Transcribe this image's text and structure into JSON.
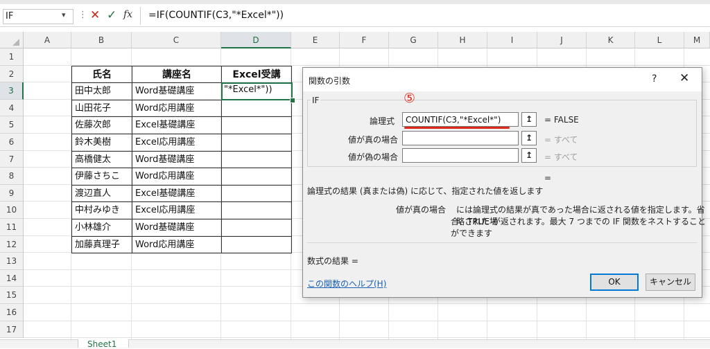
{
  "formula_bar": {
    "name_box": "IF",
    "dropdown_icon": "chevron-down-icon",
    "separator": "⋮",
    "cancel_icon": "✕",
    "enter_icon": "✓",
    "fx_label": "fx",
    "formula": "=IF(COUNTIF(C3,\"*Excel*\"))"
  },
  "grid": {
    "columns": [
      "A",
      "B",
      "C",
      "D",
      "E",
      "F",
      "G",
      "H",
      "I",
      "J",
      "K",
      "L",
      "M"
    ],
    "rows": [
      "1",
      "2",
      "3",
      "4",
      "5",
      "6",
      "7",
      "8",
      "9",
      "10",
      "11",
      "12",
      "13",
      "14",
      "15",
      "16",
      "17"
    ],
    "selected_column": "D",
    "selected_row": "3"
  },
  "table": {
    "headers": [
      "氏名",
      "講座名",
      "Excel受講"
    ],
    "rows": [
      [
        "田中太郎",
        "Word基礎講座"
      ],
      [
        "山田花子",
        "Word応用講座"
      ],
      [
        "佐藤次郎",
        "Excel基礎講座"
      ],
      [
        "鈴木美樹",
        "Excel応用講座"
      ],
      [
        "高橋健太",
        "Word基礎講座"
      ],
      [
        "伊藤さちこ",
        "Word応用講座"
      ],
      [
        "渡辺直人",
        "Excel基礎講座"
      ],
      [
        "中村みゆき",
        "Excel応用講座"
      ],
      [
        "小林雄介",
        "Word基礎講座"
      ],
      [
        "加藤真理子",
        "Word応用講座"
      ]
    ],
    "active_cell_text": "\"*Excel*\"))"
  },
  "sheet_tab": "Sheet1",
  "dialog": {
    "title": "関数の引数",
    "help_button": "?",
    "close_button": "✕",
    "function_name": "IF",
    "args": [
      {
        "label": "論理式",
        "value": "COUNTIF(C3,\"*Excel*\")",
        "result": "= FALSE"
      },
      {
        "label": "値が真の場合",
        "value": "",
        "result": "= すべて"
      },
      {
        "label": "値が偽の場合",
        "value": "",
        "result": "= すべて"
      }
    ],
    "ref_button_icon": "↥",
    "overall_equals": "=",
    "function_description": "論理式の結果 (真または偽) に応じて、指定された値を返します",
    "arg_description_label": "値が真の場合",
    "arg_description_line1": "には論理式の結果が真であった場合に返される値を指定します。省略された場",
    "arg_description_line2": "合、TRUE が返されます。最大 7 つまでの IF 関数をネストすることができます",
    "formula_result": "数式の結果 =",
    "help_link": "この関数のヘルプ(H)",
    "ok_label": "OK",
    "cancel_label": "キャンセル"
  },
  "annotation": {
    "step_marker": "⑤",
    "color": "#e0271c"
  },
  "colors": {
    "excel_green": "#217346",
    "dialog_bg": "#f0f0f0",
    "link_blue": "#1a5fb4"
  }
}
